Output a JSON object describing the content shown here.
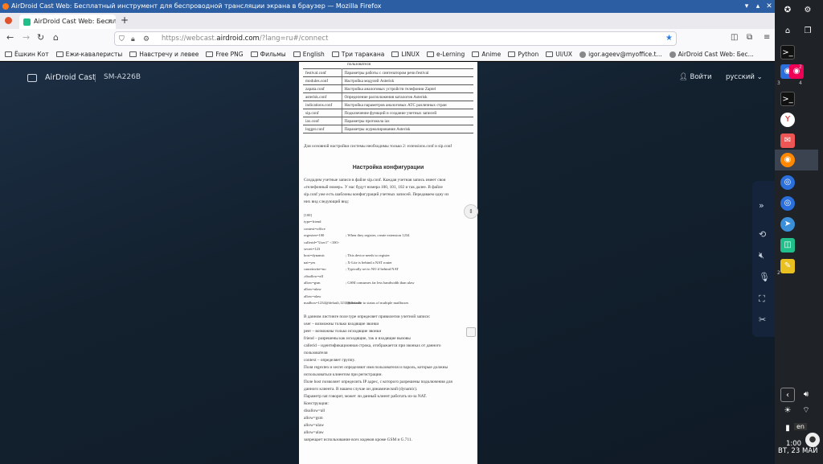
{
  "window": {
    "title": "AirDroid Cast Web: Бесплатный инструмент для беспроводной трансляции экрана в браузер — Mozilla Firefox"
  },
  "tab": {
    "title": "AirDroid Cast Web: Бесплат",
    "close": "×",
    "new": "+"
  },
  "url": {
    "prefix": "https://webcast.",
    "domain": "airdroid.com",
    "suffix": "/?lang=ru#/connect"
  },
  "bookmarks": [
    "Ёшкин Кот",
    "Ежи-кавалеристы",
    "Навстречу и левее",
    "Free PNG",
    "Фильмы",
    "English",
    "Три таракана",
    "LINUX",
    "e-Lerning",
    "Anime",
    "Python",
    "UI/UX",
    "igor.ageev@myoffice.t...",
    "AirDroid Cast Web: Бес..."
  ],
  "app": {
    "name": "AirDroid Cast",
    "device": "SM-A226B",
    "login": "Войти",
    "language": "русский"
  },
  "doc": {
    "toprow": "пользователя",
    "table": [
      [
        "festival.conf",
        "Параметры работы с синтезатором речи festival"
      ],
      [
        "modules.conf",
        "Настройка модулей Asterisk"
      ],
      [
        "zapata.conf",
        "Настройка аналоговых устройств телефонии Zaptel"
      ],
      [
        "asterisk.conf",
        "Определение расположения каталогов Asterisk"
      ],
      [
        "indications.conf",
        "Настройка параметров аналоговых АТС различных стран"
      ],
      [
        "sip.conf",
        "Подключение функций и создание учетных записей"
      ],
      [
        "iax.conf",
        "Параметры протокола iax"
      ],
      [
        "logger.conf",
        "Параметры журналирования Asterisk"
      ]
    ],
    "note": "Для основной настройки системы необходимы только 2: extensions.conf и sip.conf",
    "heading": "Настройка конфигурации",
    "intro": [
      "Создадим учетные записи в файле sip.conf. Каждая учетная запись имеет свои",
      "«телефонный номер». У нас будут номера 100, 101, 102 и так далее. В файле",
      "sip.conf уже есть шаблоны конфигураций учетных записей. Передаваем одну из",
      "них вид следующий вид:"
    ],
    "config": [
      [
        "[100]",
        ""
      ],
      [
        "type=friend",
        ""
      ],
      [
        "context=office",
        ""
      ],
      [
        "regexten=100",
        "; When they register, create extension 1234"
      ],
      [
        "callerid=\"User1\" <100>",
        ""
      ],
      [
        "secret=123",
        ""
      ],
      [
        "host=dynamic",
        "; This device needs to register"
      ],
      [
        "nat=yes",
        "; X-Lite is behind a NAT router"
      ],
      [
        "canreinvite=no",
        "; Typically set to NO if behind NAT"
      ],
      [
        ";disallow=all",
        ""
      ],
      [
        "allow=gsm",
        "; GSM consumes far less bandwidth than ulaw"
      ],
      [
        "allow=ulaw",
        ""
      ],
      [
        "allow=alaw",
        ""
      ],
      [
        "mailbox=1234@default,1233@default",
        "; Subscribe to status of multiple mailboxes"
      ]
    ],
    "body": [
      "В данном листинге поле type определяет привилегии учетной записи:",
      "user – возможны только входящие звонки",
      "peer – возможны только исходящие звонки",
      "friend – разрешены как исходящие, так и входящие вызовы",
      "callerid – идентификационная строка, отображается при звонках от данного",
      "пользователя",
      "context – определяет группу.",
      "Поля regexten и secret определяют имя пользователя и пароль, которые должны",
      "использоваться клиентом при регистрации.",
      "Поле host позволяет определить IP адрес, с которого разрешены подключения для",
      "данного клиента. В нашем случае он динамический (dynamic).",
      "Параметр nat говорит, может ли данный клиент работать из-за NAT.",
      "Конструкция:",
      "disallow=all",
      "allow=gsm",
      "allow=ulaw",
      "allow=alaw",
      "запрещает использование всех кодеков кроме GSM и G.711."
    ]
  },
  "taskbar": {
    "lang": "en",
    "time": "1:00",
    "date": "ВТ, 23 МАЙ",
    "ws": [
      "1",
      "2",
      "3",
      "4"
    ]
  }
}
